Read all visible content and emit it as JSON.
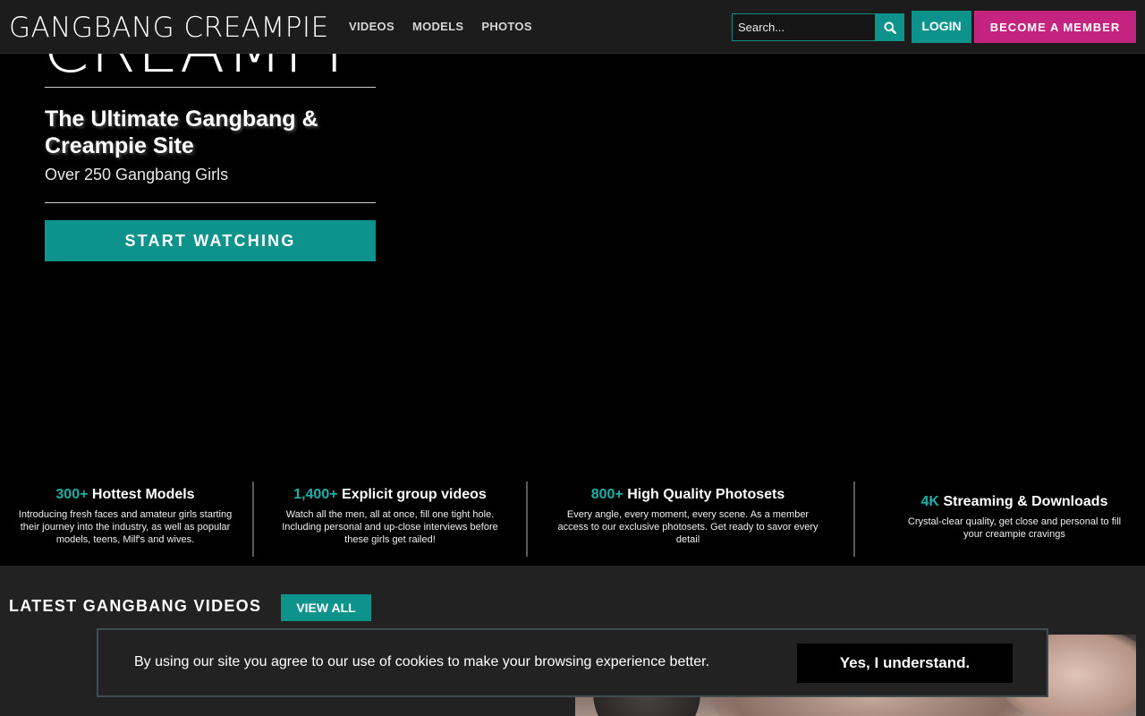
{
  "header": {
    "logo_text": "GANGBANG CREAMPIE",
    "nav": [
      {
        "label": "VIDEOS"
      },
      {
        "label": "MODELS"
      },
      {
        "label": "PHOTOS"
      }
    ],
    "search": {
      "placeholder": "Search...",
      "value": ""
    },
    "search_icon": "search-icon",
    "login_label": "LOGIN",
    "member_label": "BECOME A MEMBER"
  },
  "hero": {
    "logo_peek": "CREAMPIE",
    "headline": "The Ultimate Gangbang & Creampie Site",
    "subheadline": "Over 250 Gangbang Girls",
    "cta_label": "START WATCHING"
  },
  "features": [
    {
      "num": "300+",
      "title": "Hottest Models",
      "desc": "Introducing fresh faces and amateur girls starting their journey into the industry, as well as popular models, teens, Milf's and wives."
    },
    {
      "num": "1,400+",
      "title": "Explicit group videos",
      "desc": "Watch all the men, all at once, fill one tight hole. Including personal and up-close interviews before these girls get railed!"
    },
    {
      "num": "800+",
      "title": "High Quality Photosets",
      "desc": "Every angle, every moment, every scene. As a member access to our exclusive photosets. Get ready to savor every detail"
    },
    {
      "num": "4K",
      "title": "Streaming & Downloads",
      "desc": "Crystal-clear quality, get close and personal to fill your creampie cravings"
    }
  ],
  "latest": {
    "title": "LATEST GANGBANG VIDEOS",
    "view_all_label": "VIEW ALL"
  },
  "cookie": {
    "text": "By using our site you agree to our use of cookies to make your browsing experience better.",
    "accept_label": "Yes, I understand."
  },
  "colors": {
    "accent_teal": "#0e938c",
    "accent_pink": "#c4237f",
    "header_bg": "#1c1c1c",
    "section_bg": "#222222"
  }
}
